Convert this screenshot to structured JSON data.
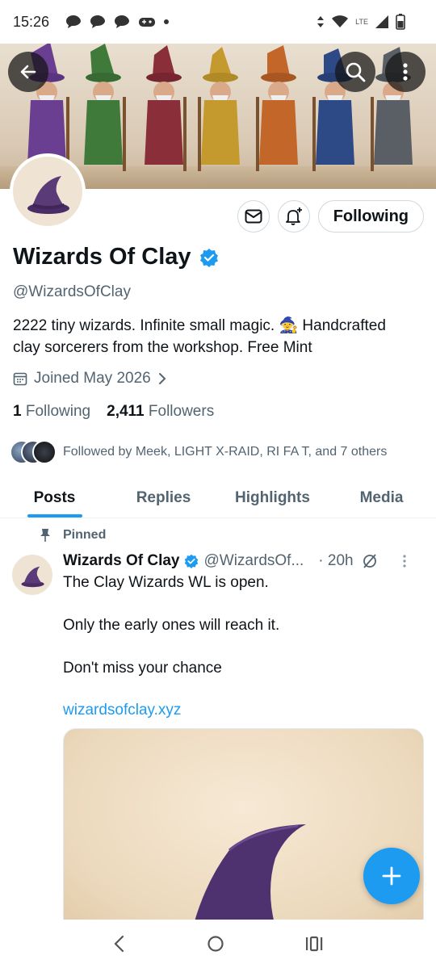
{
  "status_bar": {
    "time": "15:26",
    "network": "LTE"
  },
  "header": {
    "back_icon": "arrow-left-icon",
    "search_icon": "search-icon",
    "more_icon": "more-vertical-icon"
  },
  "profile": {
    "name": "Wizards Of Clay",
    "handle": "@WizardsOfClay",
    "bio_line1": "2222 tiny wizards. Infinite small magic. 🧙  Handcrafted",
    "bio_line2": "clay sorcerers from the workshop.  Free Mint",
    "joined": "Joined May 2026",
    "following_count": "1",
    "following_label": "Following",
    "followers_count": "2,411",
    "followers_label": "Followers",
    "followed_by": "Followed by Meek, LIGHT X-RAID, RI FA T, and 7 others",
    "follow_button": "Following"
  },
  "tabs": [
    {
      "label": "Posts",
      "active": true
    },
    {
      "label": "Replies",
      "active": false
    },
    {
      "label": "Highlights",
      "active": false
    },
    {
      "label": "Media",
      "active": false
    }
  ],
  "pinned_post": {
    "pinned_label": "Pinned",
    "author": "Wizards Of Clay",
    "handle": "@WizardsOf...",
    "time": "· 20h",
    "line1": "The Clay Wizards WL is open.",
    "line2": "Only the early ones will reach it.",
    "line3": "Don't miss your chance",
    "link": "wizardsofclay.xyz"
  },
  "colors": {
    "accent": "#1d9bf0",
    "text": "#0f1419",
    "muted": "#536471",
    "hat_purple": "#5b3a78"
  }
}
